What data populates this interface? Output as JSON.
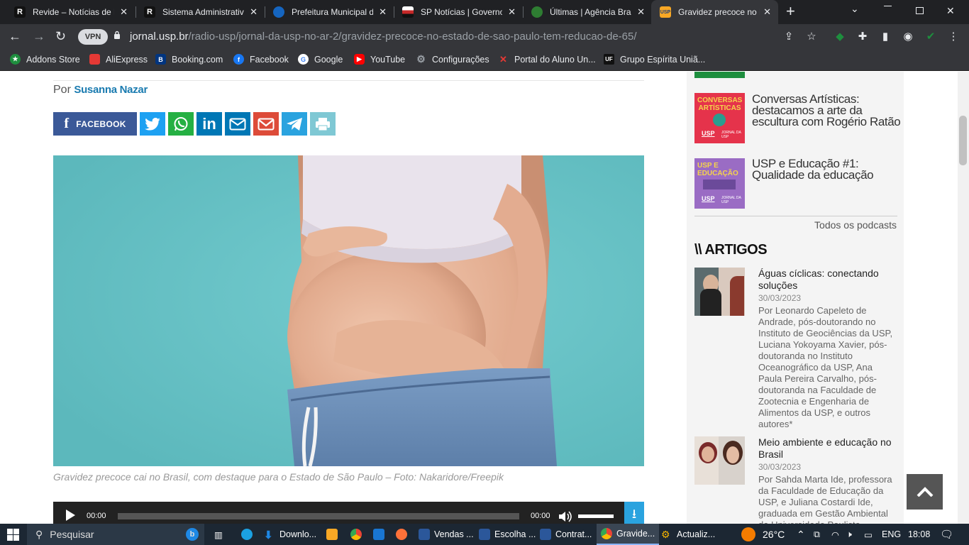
{
  "browser": {
    "tabs": [
      {
        "title": "Revide – Notícias de Ribeirão",
        "icon": "R",
        "color": "#111111"
      },
      {
        "title": "Sistema Administrativo",
        "icon": "R",
        "color": "#111111"
      },
      {
        "title": "Prefeitura Municipal de",
        "icon": "globe",
        "color": "#1565c0"
      },
      {
        "title": "SP Notícias | Governo",
        "icon": "sp",
        "color": "#c62828"
      },
      {
        "title": "Últimas | Agência Brasil",
        "icon": "br",
        "color": "#2e7d32"
      },
      {
        "title": "Gravidez precoce no Estado",
        "icon": "USP",
        "color": "#f9a825"
      }
    ],
    "url_domain": "jornal.usp.br",
    "url_path": "/radio-usp/jornal-da-usp-no-ar-2/gravidez-precoce-no-estado-de-sao-paulo-tem-reducao-de-65/",
    "vpn_label": "VPN",
    "bookmarks": [
      {
        "label": "Addons Store",
        "color": "#1e8e3e"
      },
      {
        "label": "AliExpress",
        "color": "#e53935"
      },
      {
        "label": "Booking.com",
        "color": "#003580"
      },
      {
        "label": "Facebook",
        "color": "#1877f2"
      },
      {
        "label": "Google",
        "color": "#ffffff"
      },
      {
        "label": "YouTube",
        "color": "#ff0000"
      },
      {
        "label": "Configurações",
        "color": "#9aa0a6"
      },
      {
        "label": "Portal do Aluno Un...",
        "color": "#b71c1c"
      },
      {
        "label": "Grupo Espírita Uniã...",
        "color": "#222222"
      }
    ]
  },
  "article": {
    "byline_prefix": "Por",
    "author": "Susanna Nazar",
    "share": {
      "facebook_label": "FACEBOOK"
    },
    "caption": "Gravidez precoce cai no Brasil, com destaque para o Estado de São Paulo – Foto: Nakaridore/Freepik",
    "player": {
      "current": "00:00",
      "duration": "00:00"
    }
  },
  "sidebar": {
    "podcasts": [
      {
        "title": "Conversas Artísticas: destacamos a arte da escultura com Rogério Ratão",
        "cover_text": "CONVERSAS ARTÍSTICAS",
        "cover_color": "#e5334b",
        "cover_text_color": "#f5d44b"
      },
      {
        "title": "USP e Educação #1: Qualidade da educação",
        "cover_text": "USP E EDUCAÇÃO",
        "cover_color": "#9a6cc4",
        "cover_text_color": "#f5d44b"
      }
    ],
    "cover_brand": "USP",
    "cover_sub": "JORNAL DA USP",
    "all_podcasts": "Todos os podcasts",
    "articles_heading": "\\\\ ARTIGOS",
    "articles": [
      {
        "title": "Águas cíclicas: conectando soluções",
        "date": "30/03/2023",
        "authors": "Por Leonardo Capeleto de Andrade, pós-doutorando no Instituto de Geociências da USP, Luciana Yokoyama Xavier, pós-doutoranda no Instituto Oceanográfico da USP, Ana Paula Pereira Carvalho, pós-doutoranda na Faculdade de Zootecnia e Engenharia de Alimentos da USP, e outros autores*"
      },
      {
        "title": "Meio ambiente e educação no Brasil",
        "date": "30/03/2023",
        "authors": "Por Sahda Marta Ide, professora da Faculdade de Educação da USP, e Juliana Costardi Ide, graduada em Gestão Ambiental da Universidade Paulista"
      }
    ]
  },
  "taskbar": {
    "search_placeholder": "Pesquisar",
    "apps": [
      {
        "label": "Downlo...",
        "color": "#1e88e5"
      },
      {
        "label": "Vendas ...",
        "color": "#2b579a"
      },
      {
        "label": "Escolha ...",
        "color": "#2b579a"
      },
      {
        "label": "Contrat...",
        "color": "#2b579a"
      },
      {
        "label": "Gravide...",
        "color": "#4285f4"
      },
      {
        "label": "Actualiz...",
        "color": "#f5b400"
      }
    ],
    "weather": "26°C",
    "lang": "ENG",
    "time": "18:08"
  }
}
